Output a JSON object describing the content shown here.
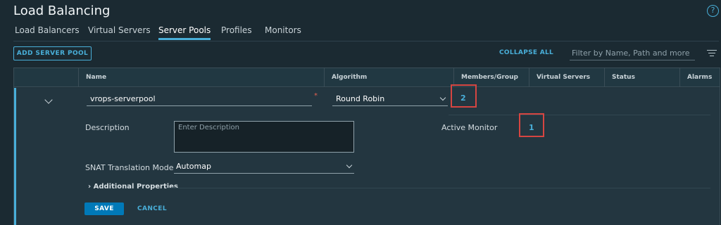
{
  "page": {
    "title": "Load Balancing"
  },
  "tabs": [
    {
      "label": "Load Balancers"
    },
    {
      "label": "Virtual Servers"
    },
    {
      "label": "Server Pools",
      "active": true
    },
    {
      "label": "Profiles"
    },
    {
      "label": "Monitors"
    }
  ],
  "toolbar": {
    "add_label": "ADD SERVER POOL",
    "collapse_label": "COLLAPSE ALL",
    "filter_placeholder": "Filter by Name, Path and more"
  },
  "table": {
    "columns": [
      "Name",
      "Algorithm",
      "Members/Group",
      "Virtual Servers",
      "Status",
      "Alarms"
    ]
  },
  "row": {
    "name_value": "vrops-serverpool",
    "required_mark": "*",
    "algorithm": "Round Robin",
    "members_count": "2",
    "description_label": "Description",
    "description_placeholder": "Enter Description",
    "active_monitor_label": "Active Monitor",
    "active_monitor_count": "1",
    "snat_label": "SNAT Translation Mode",
    "snat_value": "Automap",
    "additional_properties": "Additional Properties",
    "save_label": "SAVE",
    "cancel_label": "CANCEL"
  },
  "colors": {
    "background": "#1b2a32",
    "accent": "#49afd9",
    "primary_button": "#0079b8",
    "highlight": "#d64541"
  },
  "icons": [
    "help-icon",
    "filter-icon",
    "chevron-down-icon",
    "chevron-right-icon"
  ]
}
